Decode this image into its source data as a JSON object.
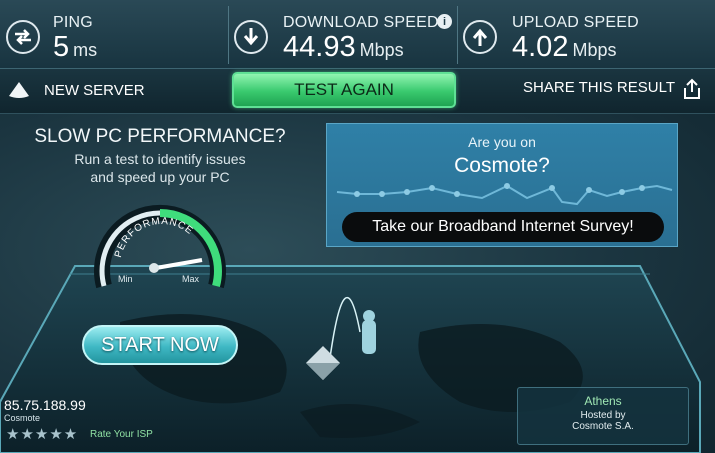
{
  "header": {
    "ping": {
      "label": "PING",
      "value": "5",
      "unit": "ms"
    },
    "download": {
      "label": "DOWNLOAD SPEED",
      "value": "44.93",
      "unit": "Mbps"
    },
    "upload": {
      "label": "UPLOAD SPEED",
      "value": "4.02",
      "unit": "Mbps"
    },
    "info_glyph": "i"
  },
  "actions": {
    "new_server": "NEW SERVER",
    "test_again": "TEST AGAIN",
    "share": "SHARE THIS RESULT"
  },
  "promo": {
    "title": "SLOW PC PERFORMANCE?",
    "subtitle_line1": "Run a test to identify issues",
    "subtitle_line2": "and speed up your PC",
    "gauge_label": "PERFORMANCE",
    "gauge_min": "Min",
    "gauge_max": "Max",
    "start_button": "START NOW"
  },
  "survey": {
    "question_line1": "Are you on",
    "question_line2": "Cosmote?",
    "button": "Take our Broadband Internet Survey!"
  },
  "client": {
    "ip": "85.75.188.99",
    "isp": "Cosmote",
    "stars": "★★★★★",
    "rating_value": 0,
    "rate_link": "Rate Your ISP"
  },
  "server": {
    "city": "Athens",
    "hosted_label": "Hosted by",
    "host": "Cosmote S.A."
  },
  "colors": {
    "accent_green": "#3fcf78",
    "survey_blue": "#2c77a0",
    "start_cyan": "#3fb8c4",
    "background": "#1b3540"
  },
  "icons": [
    "ping-icon",
    "download-icon",
    "upload-icon",
    "info-icon",
    "new-server-icon",
    "share-icon",
    "performance-gauge-icon",
    "star-icon"
  ]
}
